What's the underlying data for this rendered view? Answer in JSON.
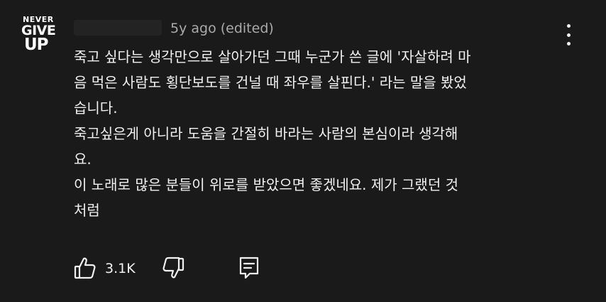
{
  "author": {
    "avatar": {
      "line1": "NEVER",
      "line2": "GIVE",
      "line3": "UP"
    },
    "timestamp": "5y ago (edited)"
  },
  "comment": {
    "lines": [
      "죽고 싶다는 생각만으로 살아가던 그때 누군가 쓴 글에 '자살하려 마",
      "음 먹은 사람도 횡단보도를 건널 때 좌우를 살핀다.' 라는 말을 봤었",
      "습니다.",
      "죽고싶은게 아니라 도움을 간절히 바라는 사람의 본심이라 생각해",
      "요.",
      "이 노래로 많은 분들이 위로를 받았으면 좋겠네요. 제가 그랬던 것",
      "처럼"
    ]
  },
  "actions": {
    "like_count": "3.1K",
    "icons": [
      "thumbs-up-icon",
      "thumbs-down-icon",
      "reply-icon",
      "more-vert-icon"
    ]
  },
  "colors": {
    "background": "#1a1a1a",
    "text": "#f1f1f1",
    "secondary_text": "#aaaaaa"
  }
}
